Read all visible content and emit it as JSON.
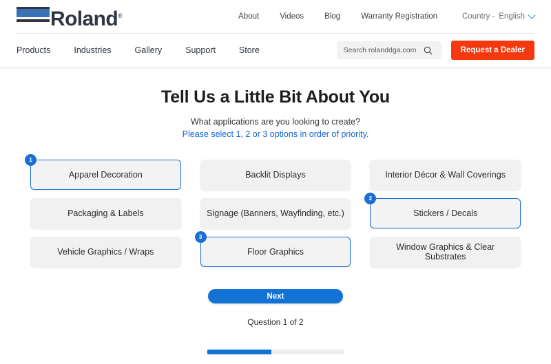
{
  "header": {
    "logo": {
      "text": "Roland",
      "registered": "®",
      "alt": "Roland"
    },
    "top_links": [
      {
        "label": "About"
      },
      {
        "label": "Videos"
      },
      {
        "label": "Blog"
      },
      {
        "label": "Warranty Registration"
      }
    ],
    "country_label": "Country -",
    "language": "English",
    "main_links": [
      {
        "label": "Products"
      },
      {
        "label": "Industries"
      },
      {
        "label": "Gallery"
      },
      {
        "label": "Support"
      },
      {
        "label": "Store"
      }
    ],
    "search": {
      "placeholder": "Search rolanddga.com",
      "value": ""
    },
    "dealer_button": "Request a Dealer"
  },
  "main": {
    "title": "Tell Us a Little Bit About You",
    "subtitle": "What applications are you looking to create?",
    "instruction": "Please select 1, 2 or 3 options in order of priority.",
    "options": [
      {
        "label": "Apparel Decoration",
        "selected": true,
        "order": "1"
      },
      {
        "label": "Backlit Displays",
        "selected": false,
        "order": ""
      },
      {
        "label": "Interior Décor & Wall Coverings",
        "selected": false,
        "order": ""
      },
      {
        "label": "Packaging & Labels",
        "selected": false,
        "order": ""
      },
      {
        "label": "Signage (Banners, Wayfinding, etc.)",
        "selected": false,
        "order": ""
      },
      {
        "label": "Stickers / Decals",
        "selected": true,
        "order": "2"
      },
      {
        "label": "Vehicle Graphics / Wraps",
        "selected": false,
        "order": ""
      },
      {
        "label": "Floor Graphics",
        "selected": true,
        "order": "3"
      },
      {
        "label": "Window Graphics & Clear Substrates",
        "selected": false,
        "order": ""
      }
    ],
    "next_button": "Next",
    "question_counter": "Question 1 of 2",
    "progress_percent": 47
  },
  "colors": {
    "accent_blue": "#1273d4",
    "dealer_red": "#f5390e",
    "logo_blue": "#3a72b8",
    "card_gray": "#f1f1f1"
  }
}
